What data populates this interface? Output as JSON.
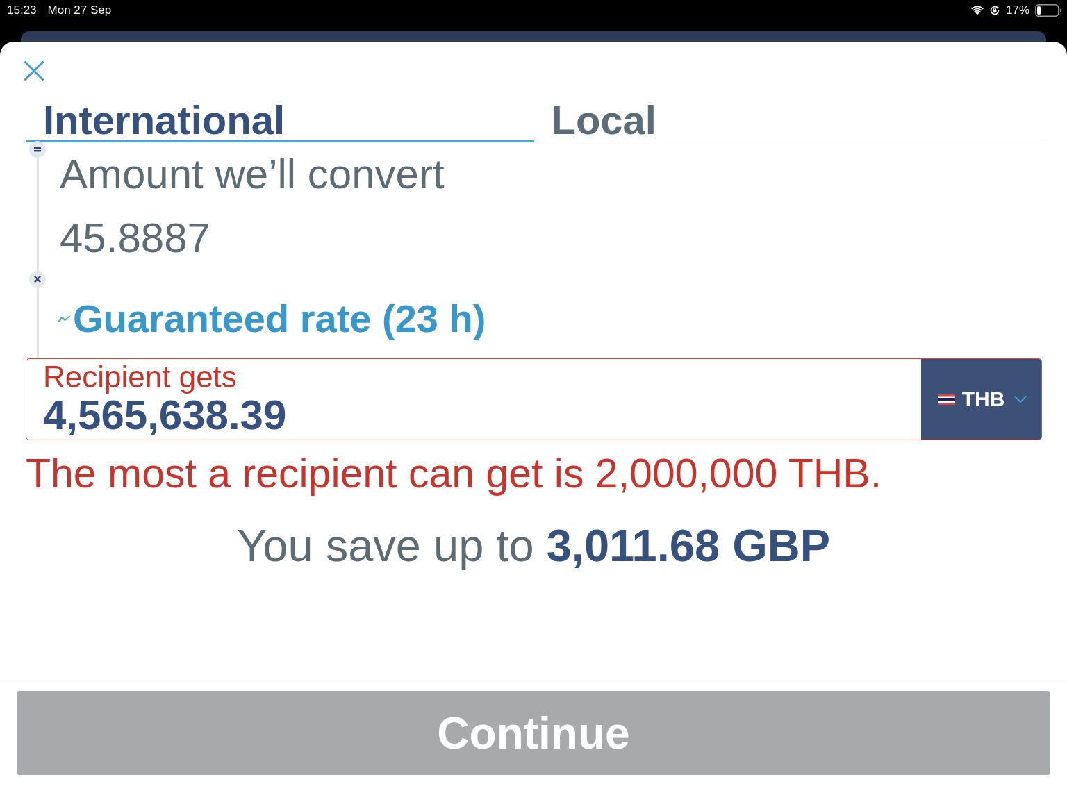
{
  "status_bar": {
    "time": "15:23",
    "date": "Mon 27 Sep",
    "battery": "17%"
  },
  "tabs": [
    {
      "label": "International",
      "selected": true
    },
    {
      "label": "Local",
      "selected": false
    }
  ],
  "conversion": {
    "label": "Amount we’ll convert",
    "value": "45.8887"
  },
  "rate": {
    "label": "Guaranteed rate (23 h)"
  },
  "recipient_field": {
    "label": "Recipient gets",
    "value": "4,565,638.39",
    "invalid": true,
    "currency": "THB"
  },
  "error": "The most a recipient can get is 2,000,000 THB.",
  "savings": "You save up to **3,011.68 GBP**",
  "continue_button": {
    "label": "Continue",
    "disabled": true
  }
}
